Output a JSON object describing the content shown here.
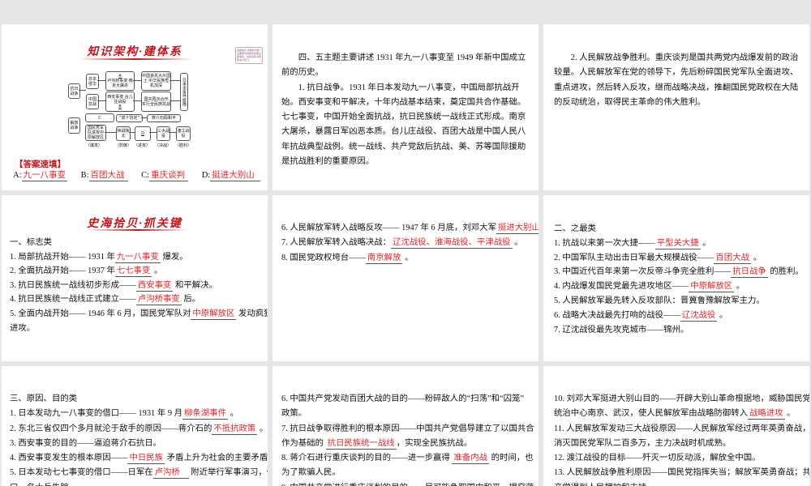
{
  "slide1": {
    "title": "知识架构·建体系",
    "note": "温馨提示 本课时内容主要按时间顺序梳理主要事件，请结合知识框架进行复习。",
    "diagram": {
      "n1": "抗日战争",
      "n2": "日本侵华",
      "n3": "中国抗战",
      "n4a": "A",
      "n4": "卢沟桥事变 南京大屠杀",
      "n5": "西安事变 台儿庄战役",
      "n5b": "B",
      "n6": "中国丧失大片国土 中华民族危机加深",
      "n7": "国共再次合作 实行全民族抗战",
      "n8": "日本无条件投降",
      "n9": "解放战争",
      "n10": "C",
      "n11": "“双十协定”",
      "n12": "蒋介石假和平",
      "n13": "国民党军队进攻中原解放区",
      "n14": "转战陕北",
      "n15": "D",
      "n16": "三大战役",
      "n17": "渡江战役",
      "stages": [
        "（爆发）",
        "（防御）",
        "（进攻）",
        "（决战）",
        "（胜利）"
      ]
    },
    "answer_heading": "【答案速填】",
    "answers": [
      {
        "label": "A:",
        "value": "九一八事变"
      },
      {
        "label": "B:",
        "value": "百团大战"
      },
      {
        "label": "C:",
        "value": "重庆谈判"
      },
      {
        "label": "D:",
        "value": "挺进大别山"
      }
    ]
  },
  "slide4_title": "史海拾贝·抓关键",
  "slides": [
    {
      "lines": [
        [
          {
            "t": "四、五主题主要讲述 1931 年九一八事变至 1949 年新中国成立前的历史。"
          }
        ],
        [
          {
            "t": "1. 抗日战争。1931 年日本发动九一八事变，中国局部抗战开始。西安事变和平解决，十年内战基本结束，奠定国共合作基础。七七事变，中国开始全面抗战，抗日民族统一战线正式形成。南京大屠杀，暴露日军凶恶本质。台儿庄战役、百团大战是中国人民八年抗战典型战例。统一战线、共产党敌后抗战、美、苏等国际援助是抗战胜利的重要原因。"
          }
        ]
      ]
    },
    {
      "lines": [
        [
          {
            "t": "2. 人民解放战争胜利。重庆谈判是国共两党内战爆发前的政治较量。人民解放军在党的领导下，先后粉碎国民党军队全面进攻、重点进攻，然后转入反攻，继而战略决战，推翻国民党政权在大陆的反动统治，取得民主革命的伟大胜利。"
          }
        ]
      ]
    },
    {
      "lines": [
        [
          {
            "t": "一、标志类"
          }
        ],
        [
          {
            "t": "1. 局部抗战开始—— 1931 年"
          },
          {
            "a": "九一八事变"
          },
          {
            "t": " 爆发。"
          }
        ],
        [
          {
            "t": "2. 全面抗战开始—— 1937 年"
          },
          {
            "a": "七七事变"
          },
          {
            "t": " 。"
          }
        ],
        [
          {
            "t": "3. 抗日民族统一战线初步形成——"
          },
          {
            "a": "西安事变"
          },
          {
            "t": " 和平解决。"
          }
        ],
        [
          {
            "t": "4. 抗日民族统一战线正式建立——"
          },
          {
            "a": "卢沟桥事变"
          },
          {
            "t": " 后。"
          }
        ],
        [
          {
            "t": "5. 全面内战开始—— 1946 年 6 月，国民党军队对"
          },
          {
            "a": "中原解放区"
          },
          {
            "t": " 发动疯狂"
          }
        ],
        [
          {
            "t": "进攻。"
          }
        ]
      ]
    },
    {
      "lines": [
        [
          {
            "t": "6. 人民解放军转入战略反攻—— 1947 年 6 月底，刘邓大军"
          },
          {
            "a": "挺进大别山"
          }
        ],
        [
          {
            "t": "7. 人民解放军转入战略决战："
          },
          {
            "a": "辽沈战役、淮海战役、平津战役"
          },
          {
            "t": " 。"
          }
        ],
        [
          {
            "t": "8. 国民党政权垮台——"
          },
          {
            "a": "南京解放"
          },
          {
            "t": " 。"
          }
        ]
      ]
    },
    {
      "lines": [
        [
          {
            "t": "二、之最类"
          }
        ],
        [
          {
            "t": "1. 抗战以来第一次大捷——"
          },
          {
            "a": "平型关大捷"
          },
          {
            "t": " 。"
          }
        ],
        [
          {
            "t": "2. 中国军队主动出击日军最大规模战役——"
          },
          {
            "a": "百团大战"
          },
          {
            "t": " 。"
          }
        ],
        [
          {
            "t": "3. 中国近代百年来第一次反帝斗争完全胜利——"
          },
          {
            "a": "抗日战争"
          },
          {
            "t": " 的胜利。"
          }
        ],
        [
          {
            "t": "4. 内战爆发国民党最先进攻地区——"
          },
          {
            "a": "中原解放区"
          },
          {
            "t": " 。"
          }
        ],
        [
          {
            "t": "5. 人民解放军最先转入反攻部队：晋冀鲁豫解放军主力。"
          }
        ],
        [
          {
            "t": "6. 战略大决战最先打响的战役——"
          },
          {
            "a": "辽沈战役"
          },
          {
            "t": " 。"
          }
        ],
        [
          {
            "t": "7. 辽沈战役最先攻克城市——锦州。"
          }
        ]
      ]
    },
    {
      "lines": [
        [
          {
            "t": "三、原因、目的类"
          }
        ],
        [
          {
            "t": "1. 日本发动九一八事变的借口—— 1931 年 9 月"
          },
          {
            "a": "柳条湖事件"
          },
          {
            "t": " 。"
          }
        ],
        [
          {
            "t": "2. 东北三省仅四个多月就沦于敌手的原因——蒋介石的"
          },
          {
            "a": "不抵抗政策"
          },
          {
            "t": " 。"
          }
        ],
        [
          {
            "t": "3. 西安事变的目的——逼迫蒋介石抗日。"
          }
        ],
        [
          {
            "t": "4. 西安事变发生的根本原因——"
          },
          {
            "a": "中日民族"
          },
          {
            "t": " 矛盾上升为社会的主要矛盾。"
          }
        ],
        [
          {
            "t": "5. 日本发动七七事变的借口——日军在"
          },
          {
            "a": "卢沟桥"
          },
          {
            "t": " 附近举行军事演习，借"
          }
        ],
        [
          {
            "t": "口一名士兵失踪。"
          }
        ]
      ]
    },
    {
      "lines": [
        [
          {
            "t": "6. 中国共产党发动百团大战的目的——粉碎敌人的“扫荡”和“囚笼”"
          }
        ],
        [
          {
            "t": "政策。"
          }
        ],
        [
          {
            "t": "7. 抗日战争取得胜利的根本原因——中国共产党倡导建立了以国共合"
          }
        ],
        [
          {
            "t": "作为基础的 "
          },
          {
            "a": "抗日民族统一战线"
          },
          {
            "t": "，实现全民族抗战。"
          }
        ],
        [
          {
            "t": "8. 蒋介石进行重庆谈判的目的——进一步赢得 "
          },
          {
            "a": "准备内战"
          },
          {
            "t": " 的时间，也"
          }
        ],
        [
          {
            "t": "为了欺骗人民。"
          }
        ],
        [
          {
            "t": "9. 中国共产党进行重庆谈判的目的——尽可能争取国内和平，揭穿蒋"
          }
        ]
      ]
    },
    {
      "lines": [
        [
          {
            "t": "10. 刘邓大军挺进大别山目的——开辟大别山革命根据地，威胁国民党"
          }
        ],
        [
          {
            "t": "统治中心南京、武汉，使人民解放军由战略防御转入"
          },
          {
            "a": "战略进攻"
          },
          {
            "t": " 。"
          }
        ],
        [
          {
            "t": "11. 人民解放军发动三大战役原因——人民解放军经过两年英勇奋战，"
          }
        ],
        [
          {
            "t": "消灭国民党军队二百多万，主力决战时机成熟。"
          }
        ],
        [
          {
            "t": "12. 渡江战役的目标——歼灭一切反动派，解放全中国。"
          }
        ],
        [
          {
            "t": "13. 人民解放战争胜利原因——国民党指挥失当；解放军英勇奋战；共"
          }
        ],
        [
          {
            "t": "产党得到人民拥护和支持。"
          }
        ]
      ]
    }
  ]
}
